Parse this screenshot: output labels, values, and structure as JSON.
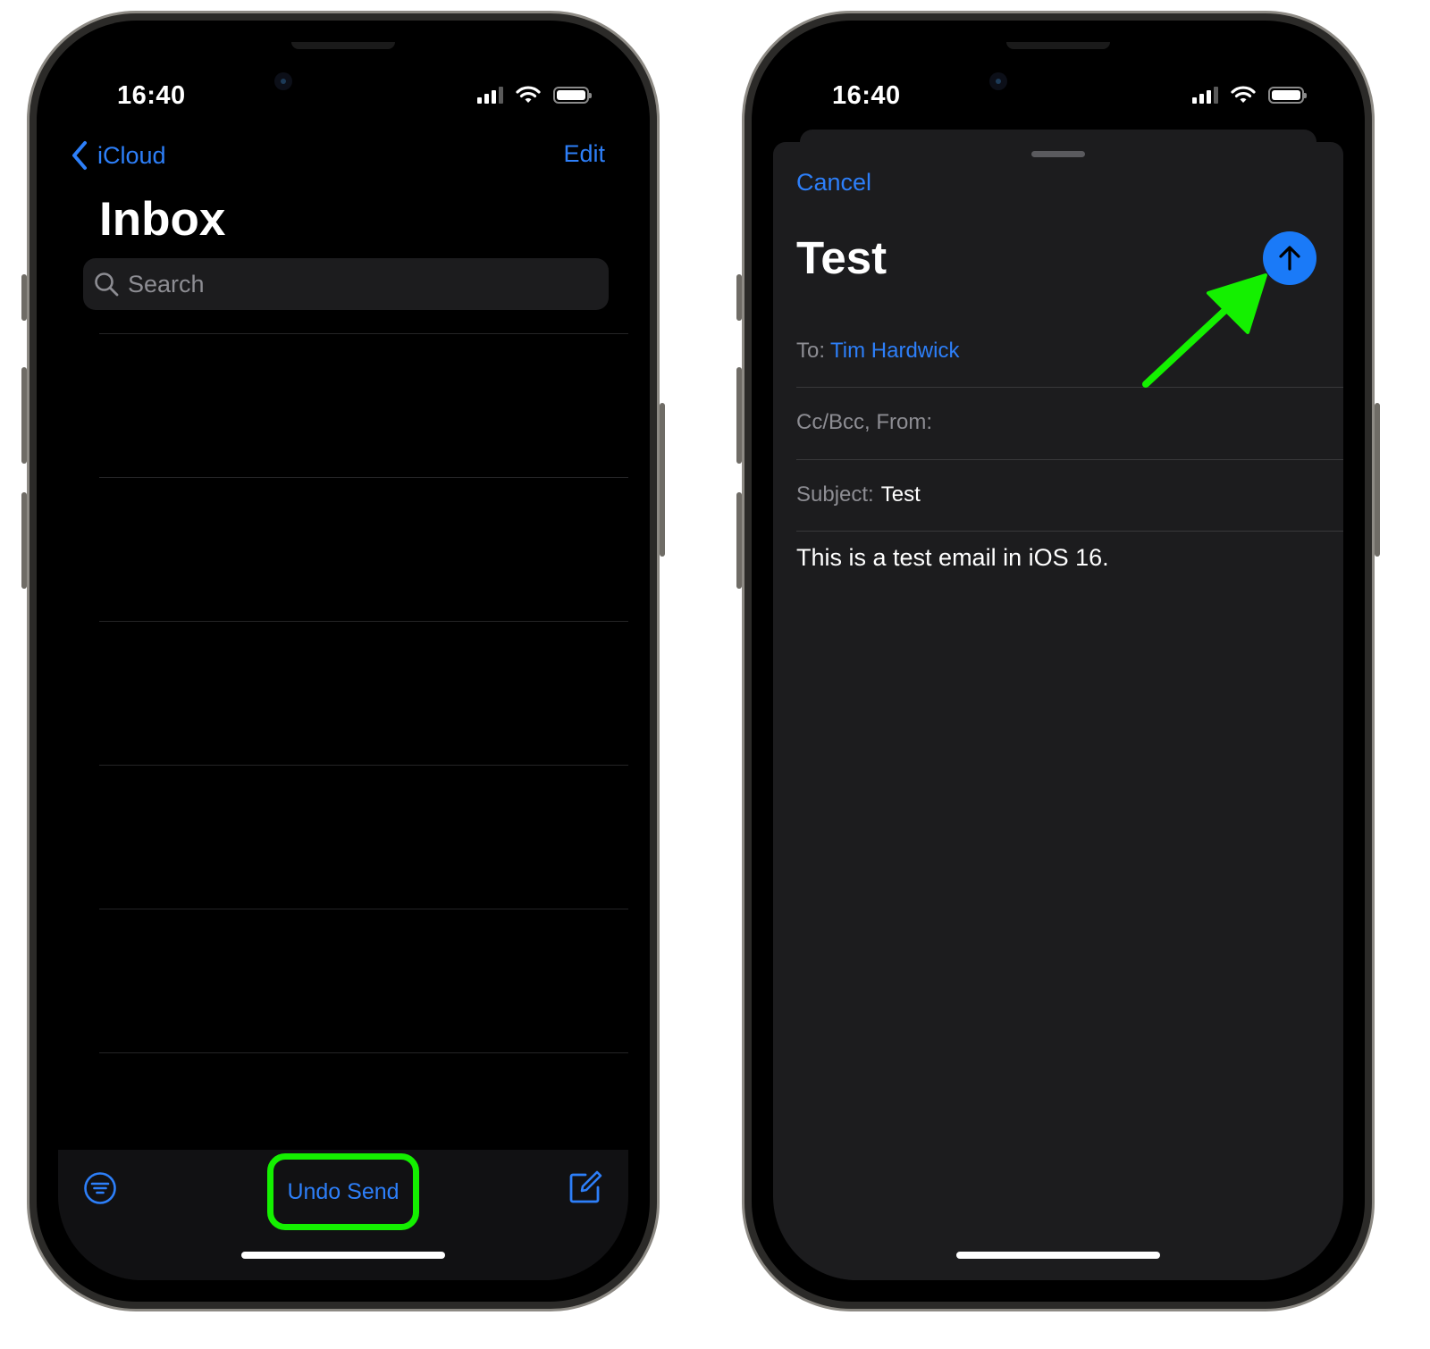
{
  "left_phone": {
    "status": {
      "time": "16:40"
    },
    "nav": {
      "back_label": "iCloud",
      "edit_label": "Edit"
    },
    "title": "Inbox",
    "search": {
      "placeholder": "Search"
    },
    "toolbar": {
      "undo_label": "Undo Send"
    }
  },
  "right_phone": {
    "status": {
      "time": "16:40"
    },
    "compose": {
      "cancel_label": "Cancel",
      "title": "Test",
      "to_label": "To:",
      "to_value": "Tim Hardwick",
      "ccbcc_label": "Cc/Bcc, From:",
      "subject_label": "Subject:",
      "subject_value": "Test",
      "body": "This is a test email in iOS 16."
    }
  },
  "colors": {
    "accent_blue": "#2d7ff9",
    "send_button": "#1a7af8",
    "highlight_green": "#14f000",
    "screen_bg": "#000000",
    "sheet_bg": "#1c1c1e"
  },
  "icons": [
    "chevron-left-icon",
    "search-icon",
    "filter-icon",
    "compose-icon",
    "send-arrow-icon",
    "wifi-icon",
    "signal-icon",
    "battery-icon"
  ]
}
